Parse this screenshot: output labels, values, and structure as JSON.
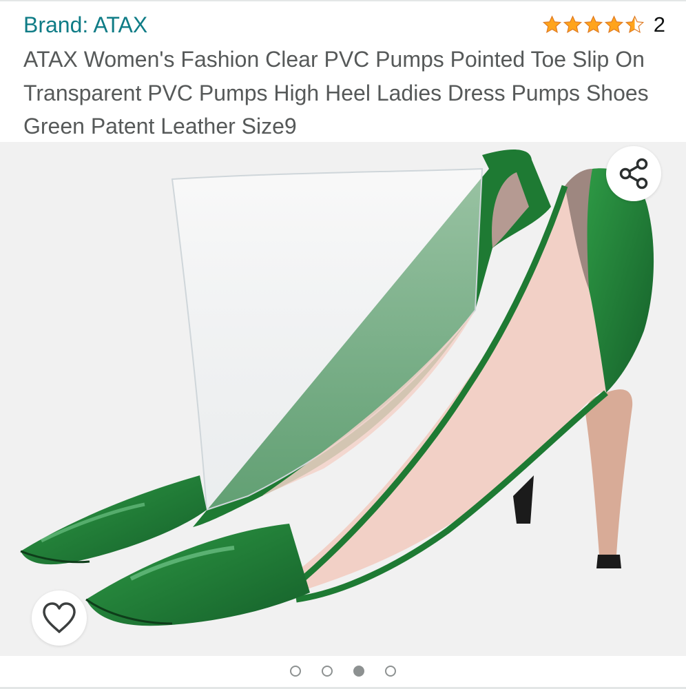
{
  "brand": {
    "label": "Brand: ATAX"
  },
  "rating": {
    "value": 4.5,
    "max": 5,
    "count": "2",
    "star_color": "#ffa41c"
  },
  "product": {
    "title": "ATAX Women's Fashion Clear PVC Pumps Pointed Toe Slip On Transparent PVC Pumps High Heel Ladies Dress Pumps Shoes Green Patent Leather Size9",
    "image": {
      "subject": "green-patent-clear-pvc-pumps",
      "primary_color": "#1f7d32"
    }
  },
  "actions": {
    "share_icon": "share-icon",
    "wishlist_icon": "heart-outline-icon"
  },
  "carousel": {
    "total": 4,
    "active_index": 3
  },
  "colors": {
    "brand_link": "#0f7c86",
    "title_text": "#565959",
    "image_bg": "#f1f1f1"
  }
}
